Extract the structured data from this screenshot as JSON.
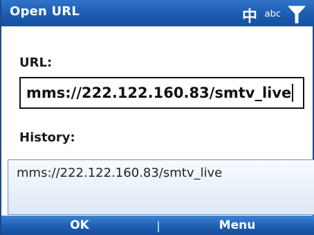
{
  "window": {
    "title": "Open URL"
  },
  "status_icons": {
    "input_mode": "中",
    "abc": "abc",
    "icons": [
      "input-mode-icon",
      "abc-icon",
      "signal-icon"
    ]
  },
  "form": {
    "url_label": "URL:",
    "url_value": "mms://222.122.160.83/smtv_live",
    "history_label": "History:",
    "history_items": [
      "mms://222.122.160.83/smtv_live"
    ]
  },
  "softkeys": {
    "left": "OK",
    "right": "Menu"
  },
  "colors": {
    "titlebar": "#1c5bb0",
    "softkey_bar": "#1c5bb0",
    "history_bg": "#dde8f6"
  }
}
